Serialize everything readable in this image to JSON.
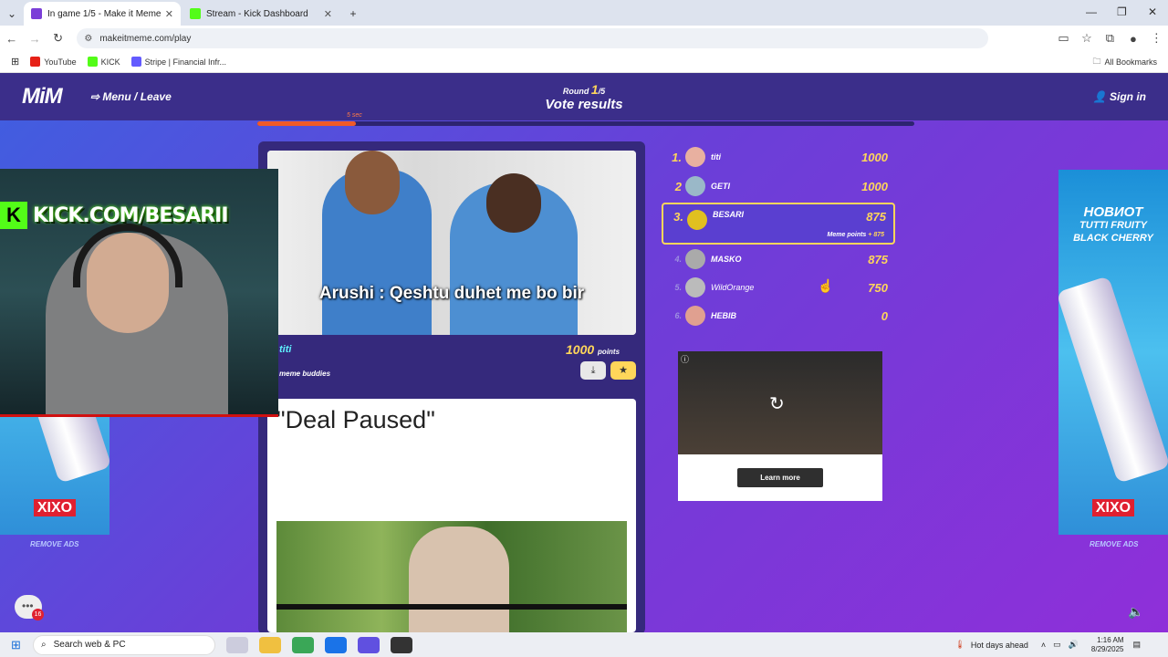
{
  "browser": {
    "tabs": [
      {
        "title": "In game 1/5 - Make it Meme",
        "active": true
      },
      {
        "title": "Stream - Kick Dashboard",
        "active": false
      }
    ],
    "url": "makeitmeme.com/play",
    "bookmarks": [
      "YouTube",
      "KICK",
      "Stripe | Financial Infr..."
    ],
    "all_bookmarks": "All Bookmarks"
  },
  "site": {
    "logo": "MiM",
    "menu": "Menu / Leave",
    "round_label": "Round",
    "round_current": "1",
    "round_total": "/5",
    "round_title": "Vote results",
    "signin": "Sign in",
    "timer_label": "5 sec",
    "timer_fraction": 0.15
  },
  "meme1": {
    "caption": "Arushi : Qeshtu duhet me bo bir",
    "author": "titi",
    "buddies": "meme buddies",
    "points": "1000",
    "points_unit": "points"
  },
  "meme2": {
    "title": "\"Deal Paused\""
  },
  "leaderboard": [
    {
      "rank": "1.",
      "name": "titi",
      "score": "1000"
    },
    {
      "rank": "2",
      "name": "GETI",
      "score": "1000"
    },
    {
      "rank": "3.",
      "name": "BESARI",
      "score": "875",
      "meme_points_label": "Meme points",
      "meme_points": "+ 875"
    },
    {
      "rank": "4.",
      "name": "MASKO",
      "score": "875"
    },
    {
      "rank": "5.",
      "name": "WildOrange",
      "score": "750"
    },
    {
      "rank": "6.",
      "name": "HEBIB",
      "score": "0"
    }
  ],
  "ads": {
    "learn_more": "Learn more",
    "left_brand": "XIXO",
    "right_brand": "XIXO",
    "right_line1": "НОВИОТ",
    "right_line2": "TUTTI FRUITY",
    "right_line3": "BLACK CHERRY",
    "remove_ads": "REMOVE ADS"
  },
  "webcam": {
    "banner": "KICK.COM/BESARII",
    "k": "K"
  },
  "chat_badge": "16",
  "taskbar": {
    "search_placeholder": "Search web & PC",
    "weather": "Hot days ahead",
    "time": "1:16 AM",
    "date": "8/29/2025"
  },
  "colors": {
    "accent": "#ffd65a",
    "header": "#3b2e8a",
    "kick_green": "#53fc18",
    "timer": "#f05a28"
  }
}
